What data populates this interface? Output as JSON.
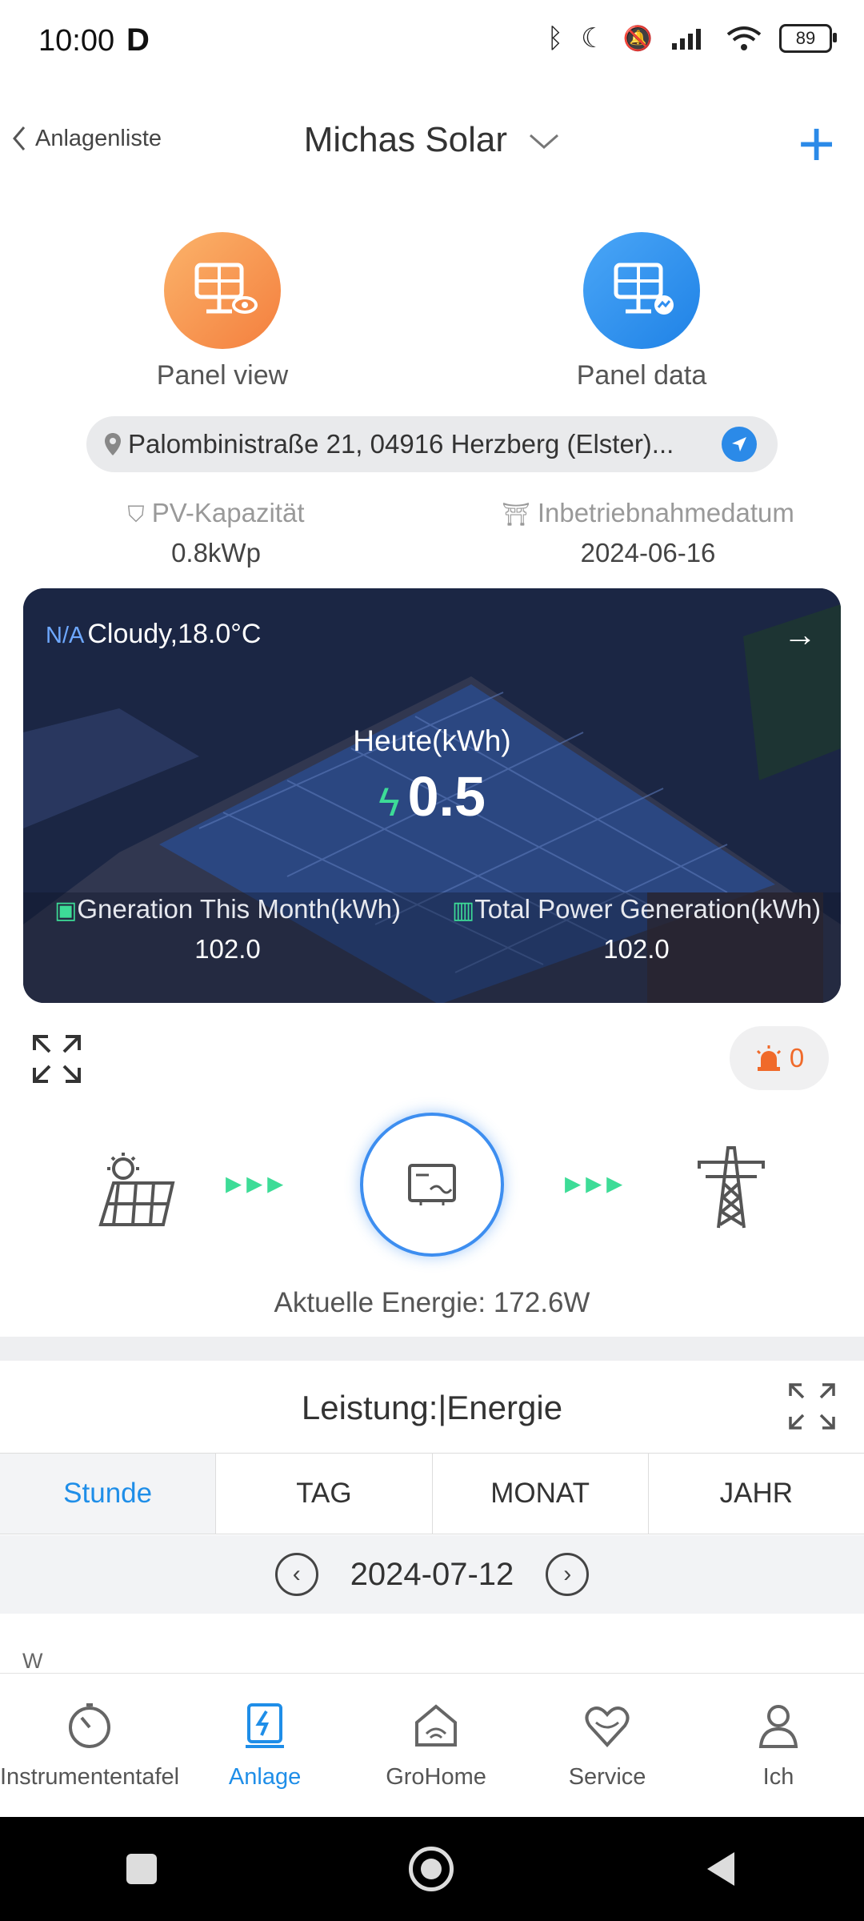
{
  "status": {
    "time": "10:00",
    "battery": "89"
  },
  "header": {
    "back_label": "Anlagenliste",
    "title": "Michas Solar"
  },
  "panel_buttons": [
    {
      "label": "Panel view",
      "color": "#f79a52"
    },
    {
      "label": "Panel data",
      "color": "#2f8ef0"
    }
  ],
  "address": "Palombinistraße 21, 04916 Herzberg (Elster)...",
  "stats": {
    "capacity_label": "PV-Kapazität",
    "capacity_value": "0.8kWp",
    "date_label": "Inbetriebnahmedatum",
    "date_value": "2024-06-16"
  },
  "hero": {
    "na": "N/A",
    "weather": "Cloudy,18.0°C",
    "today_label": "Heute(kWh)",
    "today_value": "0.5",
    "month_label": "Gneration This Month(kWh)",
    "month_value": "102.0",
    "total_label": "Total Power Generation(kWh)",
    "total_value": "102.0"
  },
  "alarm_count": "0",
  "current_energy": "Aktuelle Energie:  172.6W",
  "power": {
    "title": "Leistung:|Energie",
    "tabs": [
      "Stunde",
      "TAG",
      "MONAT",
      "JAHR"
    ],
    "date": "2024-07-12",
    "axis_unit": "W"
  },
  "nav": [
    {
      "label": "Instrumententafel",
      "icon": "gauge-icon"
    },
    {
      "label": "Anlage",
      "icon": "plant-icon"
    },
    {
      "label": "GroHome",
      "icon": "home-icon"
    },
    {
      "label": "Service",
      "icon": "heart-icon"
    },
    {
      "label": "Ich",
      "icon": "person-icon"
    }
  ],
  "colors": {
    "accent": "#1f8ee8",
    "green": "#3ddc97",
    "alarm": "#f06a2a"
  }
}
